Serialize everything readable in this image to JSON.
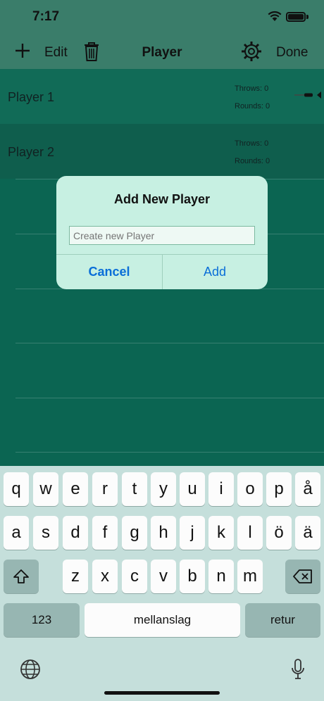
{
  "status_bar": {
    "time": "7:17"
  },
  "nav": {
    "edit_label": "Edit",
    "title": "Player",
    "done_label": "Done"
  },
  "players": [
    {
      "name": "Player 1",
      "throws": "Throws: 0",
      "rounds": "Rounds: 0"
    },
    {
      "name": "Player 2",
      "throws": "Throws: 0",
      "rounds": "Rounds: 0"
    }
  ],
  "dialog": {
    "title": "Add New Player",
    "placeholder": "Create new Player",
    "value": "",
    "cancel_label": "Cancel",
    "add_label": "Add"
  },
  "keyboard": {
    "row1": [
      "q",
      "w",
      "e",
      "r",
      "t",
      "y",
      "u",
      "i",
      "o",
      "p",
      "å"
    ],
    "row2": [
      "a",
      "s",
      "d",
      "f",
      "g",
      "h",
      "j",
      "k",
      "l",
      "ö",
      "ä"
    ],
    "row3": [
      "z",
      "x",
      "c",
      "v",
      "b",
      "n",
      "m"
    ],
    "numbers_label": "123",
    "space_label": "mellanslag",
    "return_label": "retur"
  },
  "colors": {
    "accent": "#0a6ed8",
    "list_bg": "#0b6552",
    "bar_bg": "#3a7d6a",
    "dialog_bg": "#c7f0e2"
  }
}
